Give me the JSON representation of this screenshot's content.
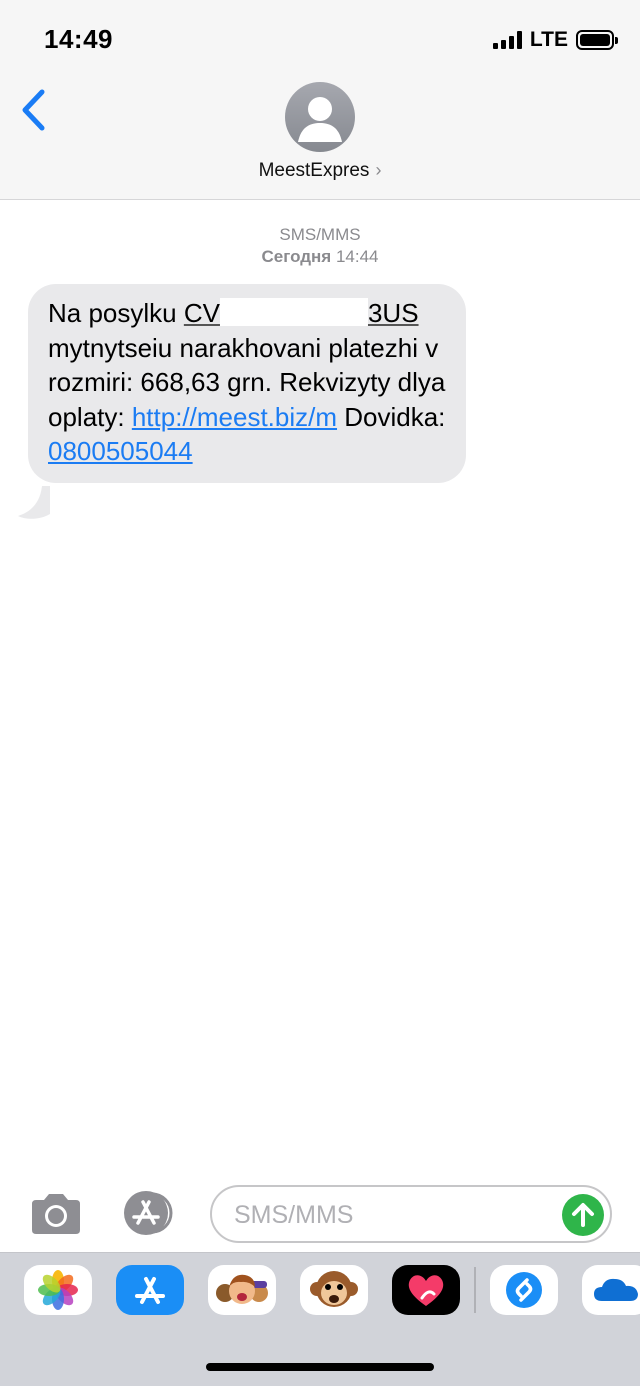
{
  "status_bar": {
    "time": "14:49",
    "network": "LTE"
  },
  "header": {
    "contact_name": "MeestExpres",
    "chevron": "›"
  },
  "thread": {
    "service": "SMS/MMS",
    "day": "Сегодня",
    "time": "14:44"
  },
  "message": {
    "prefix": "Na posylku ",
    "tracking_start": "CV",
    "tracking_end": "3US",
    "line2": "mytnytseiu narakhovani platezhi v rozmiri: 668,63 grn.",
    "line3": "Rekvizyty dlya oplaty: ",
    "link": "http://meest.biz/m",
    "help_label": " Dovidka: ",
    "phone": "0800505044"
  },
  "composer": {
    "placeholder": "SMS/MMS"
  },
  "app_drawer": {
    "apps": [
      "photos-icon",
      "app-store-icon",
      "memoji-icon",
      "animoji-monkey-icon",
      "digital-touch-icon",
      "shazam-icon",
      "onedrive-icon"
    ]
  },
  "colors": {
    "link": "#1b7cf3",
    "bubble": "#e9e9eb",
    "accent": "#1a7cf5",
    "send": "#2fb54a"
  }
}
